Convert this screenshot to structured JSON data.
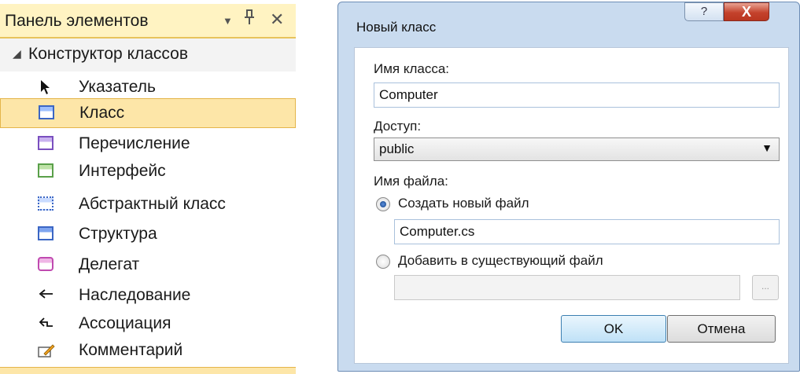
{
  "toolbox": {
    "title": "Панель элементов",
    "header_icons": [
      "dropdown-icon",
      "pin-icon",
      "close-icon"
    ],
    "group": {
      "label": "Конструктор классов",
      "expanded": true
    },
    "items": [
      {
        "label": "Указатель",
        "icon": "pointer-arrow-icon"
      },
      {
        "label": "Класс",
        "icon": "class-icon",
        "selected": true
      },
      {
        "label": "Перечисление",
        "icon": "enum-icon"
      },
      {
        "label": "Интерфейс",
        "icon": "interface-icon"
      },
      {
        "label": "Абстрактный класс",
        "icon": "abstract-class-icon"
      },
      {
        "label": "Структура",
        "icon": "struct-icon"
      },
      {
        "label": "Делегат",
        "icon": "delegate-icon"
      },
      {
        "label": "Наследование",
        "icon": "inheritance-arrow-icon"
      },
      {
        "label": "Ассоциация",
        "icon": "association-arrow-icon"
      },
      {
        "label": "Комментарий",
        "icon": "comment-icon"
      }
    ]
  },
  "dialog": {
    "title": "Новый класс",
    "help_glyph": "?",
    "close_glyph": "X",
    "class_name_label": "Имя класса:",
    "class_name_value": "Computer",
    "access_label": "Доступ:",
    "access_value": "public",
    "file_name_label": "Имя файла:",
    "new_file_option": "Создать новый файл",
    "new_file_value": "Computer.cs",
    "existing_file_option": "Добавить в существующий файл",
    "existing_file_value": "",
    "browse_label": "...",
    "ok_label": "OK",
    "cancel_label": "Отмена"
  },
  "colors": {
    "selection": "#fde6a8",
    "dialog_frame": "#c9dbef",
    "close_button": "#c4422c"
  }
}
